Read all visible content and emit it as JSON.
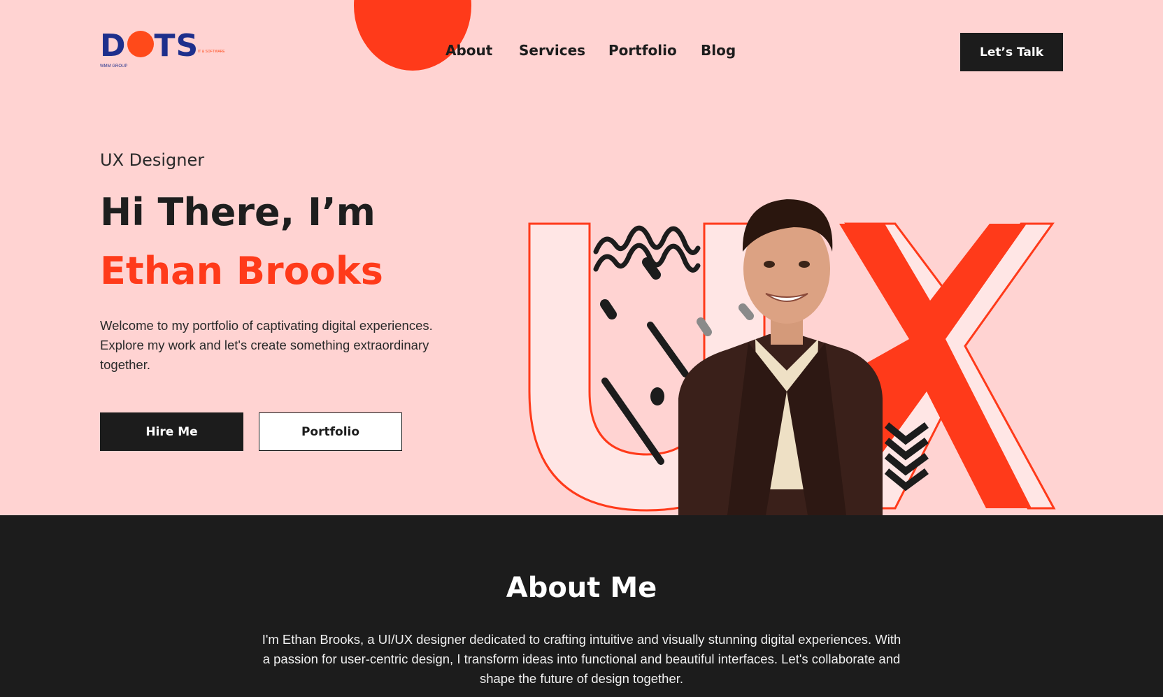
{
  "header": {
    "logo": {
      "text": "DOTS",
      "sub_text": "WMM GROUP",
      "tagline": "IT & SOFTWARE"
    },
    "nav": [
      {
        "label": "About"
      },
      {
        "label": "Services"
      },
      {
        "label": "Portfolio"
      },
      {
        "label": "Blog"
      }
    ],
    "cta_label": "Let’s Talk"
  },
  "hero": {
    "role": "UX Designer",
    "greeting": "Hi There, I’m",
    "name": "Ethan Brooks",
    "intro": "Welcome to my portfolio of captivating digital experiences. Explore my work and let's create something extraordinary together.",
    "buttons": {
      "hire": "Hire Me",
      "portfolio": "Portfolio"
    },
    "art_letters": "UX"
  },
  "about": {
    "title": "About Me",
    "text": "I'm Ethan Brooks, a UI/UX designer dedicated to crafting intuitive and visually stunning digital experiences. With a passion for user-centric design, I transform ideas into functional and beautiful interfaces. Let's collaborate and shape the future of design together."
  },
  "colors": {
    "hero_bg": "#ffd3d2",
    "accent": "#ff3a1a",
    "dark": "#1c1c1c",
    "logo_blue": "#1e2f8c"
  }
}
